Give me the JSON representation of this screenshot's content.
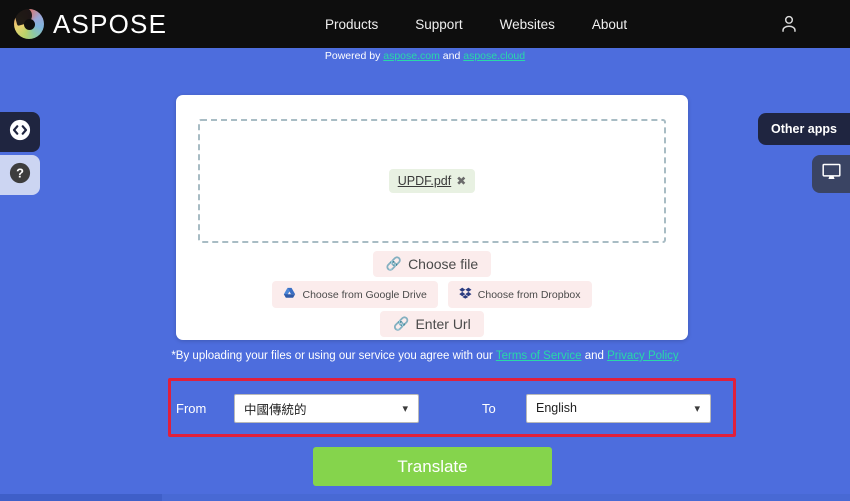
{
  "topbar": {
    "brand": "ASPOSE",
    "brand_logo_icon": "aspose-swirl-logo",
    "nav": [
      {
        "label": "Products"
      },
      {
        "label": "Support"
      },
      {
        "label": "Websites"
      },
      {
        "label": "About"
      }
    ],
    "account_icon": "user-icon"
  },
  "powered": {
    "prefix": "Powered by ",
    "link1": "aspose.com",
    "middle": " and ",
    "link2": "aspose.cloud"
  },
  "upload": {
    "file_name": "UPDF.pdf",
    "remove_icon": "close-icon",
    "choose_file": "Choose file",
    "choose_file_icon": "paperclip-icon",
    "google_drive": "Choose from Google Drive",
    "google_drive_icon": "google-drive-icon",
    "dropbox": "Choose from Dropbox",
    "dropbox_icon": "dropbox-icon",
    "enter_url": "Enter Url",
    "enter_url_icon": "paperclip-icon"
  },
  "terms": {
    "text": "*By uploading your files or using our service you agree with our ",
    "tos": "Terms of Service",
    "and": " and ",
    "privacy": "Privacy Policy"
  },
  "language": {
    "from_label": "From",
    "from_value": "中國傳統的",
    "to_label": "To",
    "to_value": "English",
    "chevron_icon": "chevron-down-icon",
    "highlight_color": "#e0203c"
  },
  "action": {
    "translate": "Translate",
    "translate_color": "#85d44c"
  },
  "side": {
    "code_icon": "code-brackets-icon",
    "help_icon": "question-mark-icon",
    "other_apps": "Other apps",
    "desktop_icon": "monitor-icon"
  }
}
